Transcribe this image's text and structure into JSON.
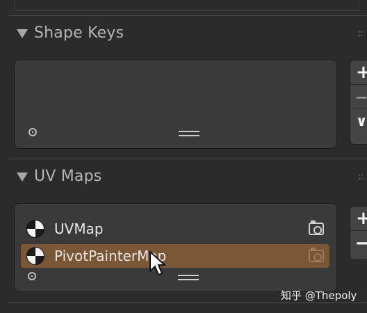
{
  "shape_keys": {
    "title": "Shape Keys",
    "side_buttons": [
      "+",
      "—",
      "∨"
    ]
  },
  "uv_maps": {
    "title": "UV Maps",
    "items": [
      {
        "name": "UVMap",
        "active": false
      },
      {
        "name": "PivotPainterMap",
        "active": true
      }
    ],
    "side_buttons": [
      "+",
      "—"
    ]
  },
  "watermark": "知乎 @Thepoly",
  "colors": {
    "background": "#2b2b2b",
    "list_bg": "#3a3a3a",
    "active_row": "#7a5634"
  }
}
